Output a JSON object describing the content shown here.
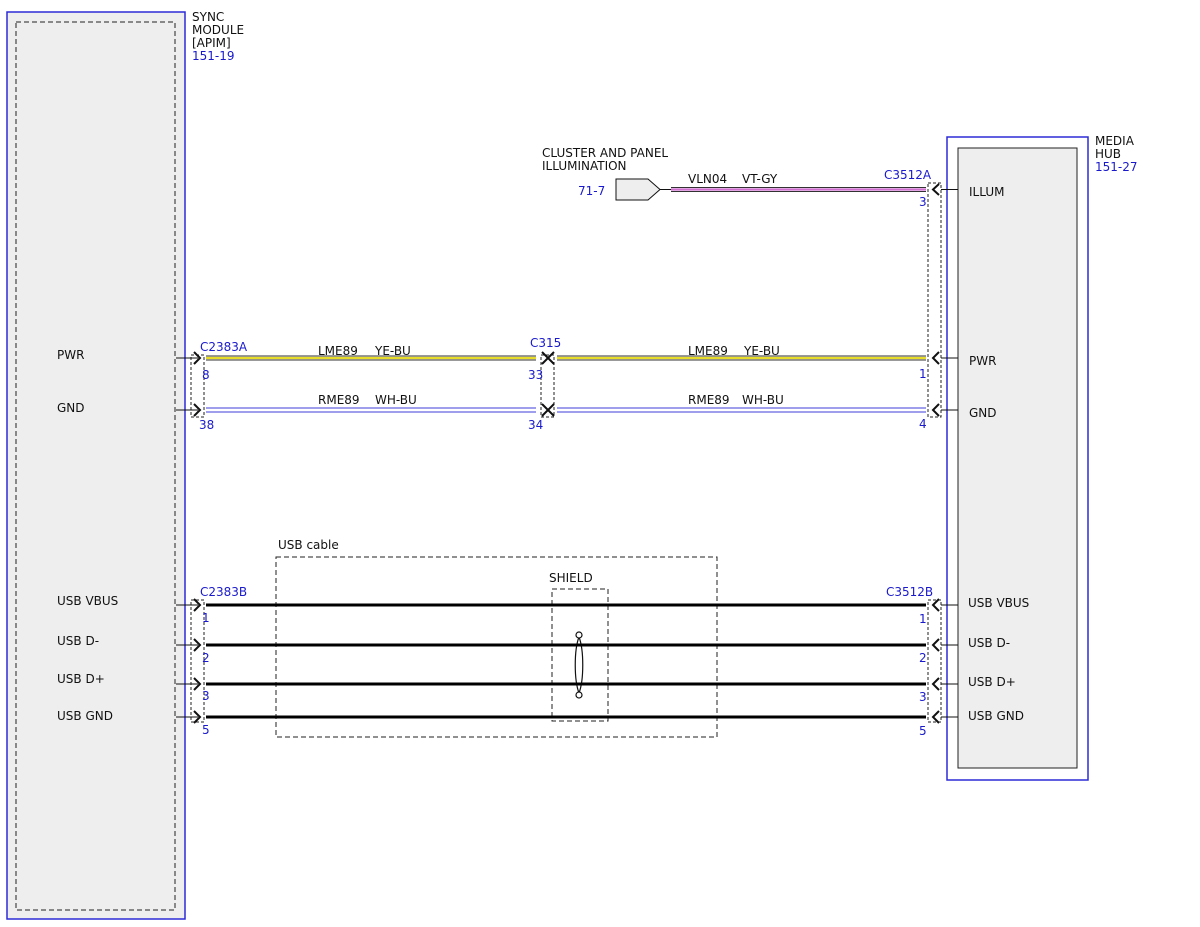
{
  "colors": {
    "module_border": "#2b2bd6",
    "module_fill": "#eeeeee",
    "reference": "#1a1acc",
    "wire_yellow": "#e8dc2a",
    "wire_blue": "#3d3dd9",
    "wire_pink": "#d06ed0",
    "usb_wire": "#000000"
  },
  "sync_module": {
    "name_line1": "SYNC",
    "name_line2": "MODULE",
    "name_line3": "[APIM]",
    "ref": "151-19",
    "pins": [
      "PWR",
      "GND",
      "USB VBUS",
      "USB D-",
      "USB D+",
      "USB GND"
    ]
  },
  "media_hub": {
    "name_line1": "MEDIA",
    "name_line2": "HUB",
    "ref": "151-27",
    "pins": [
      "ILLUM",
      "PWR",
      "GND",
      "USB VBUS",
      "USB D-",
      "USB D+",
      "USB GND"
    ]
  },
  "illumination": {
    "label_line1": "CLUSTER AND PANEL",
    "label_line2": "ILLUMINATION",
    "ref": "71-7",
    "circuit": "VLN04",
    "color": "VT-GY",
    "connector": "C3512A",
    "pin": "3"
  },
  "connectors": {
    "c2383a": "C2383A",
    "c315": "C315",
    "c3512a": "C3512A",
    "c2383b": "C2383B",
    "c3512b": "C3512B"
  },
  "power_wires": {
    "pwr_left_circuit": "LME89",
    "pwr_left_color": "YE-BU",
    "pwr_right_circuit": "LME89",
    "pwr_right_color": "YE-BU",
    "gnd_left_circuit": "RME89",
    "gnd_left_color": "WH-BU",
    "gnd_right_circuit": "RME89",
    "gnd_right_color": "WH-BU",
    "pin_pwr_apim": "8",
    "pin_pwr_c315_left": "33",
    "pin_pwr_hub": "1",
    "pin_gnd_apim": "38",
    "pin_gnd_c315_left": "34",
    "pin_gnd_hub": "4"
  },
  "usb": {
    "cable_label": "USB cable",
    "shield_label": "SHIELD",
    "left_pins": [
      "1",
      "2",
      "3",
      "5"
    ],
    "right_pins": [
      "1",
      "2",
      "3",
      "5"
    ]
  }
}
